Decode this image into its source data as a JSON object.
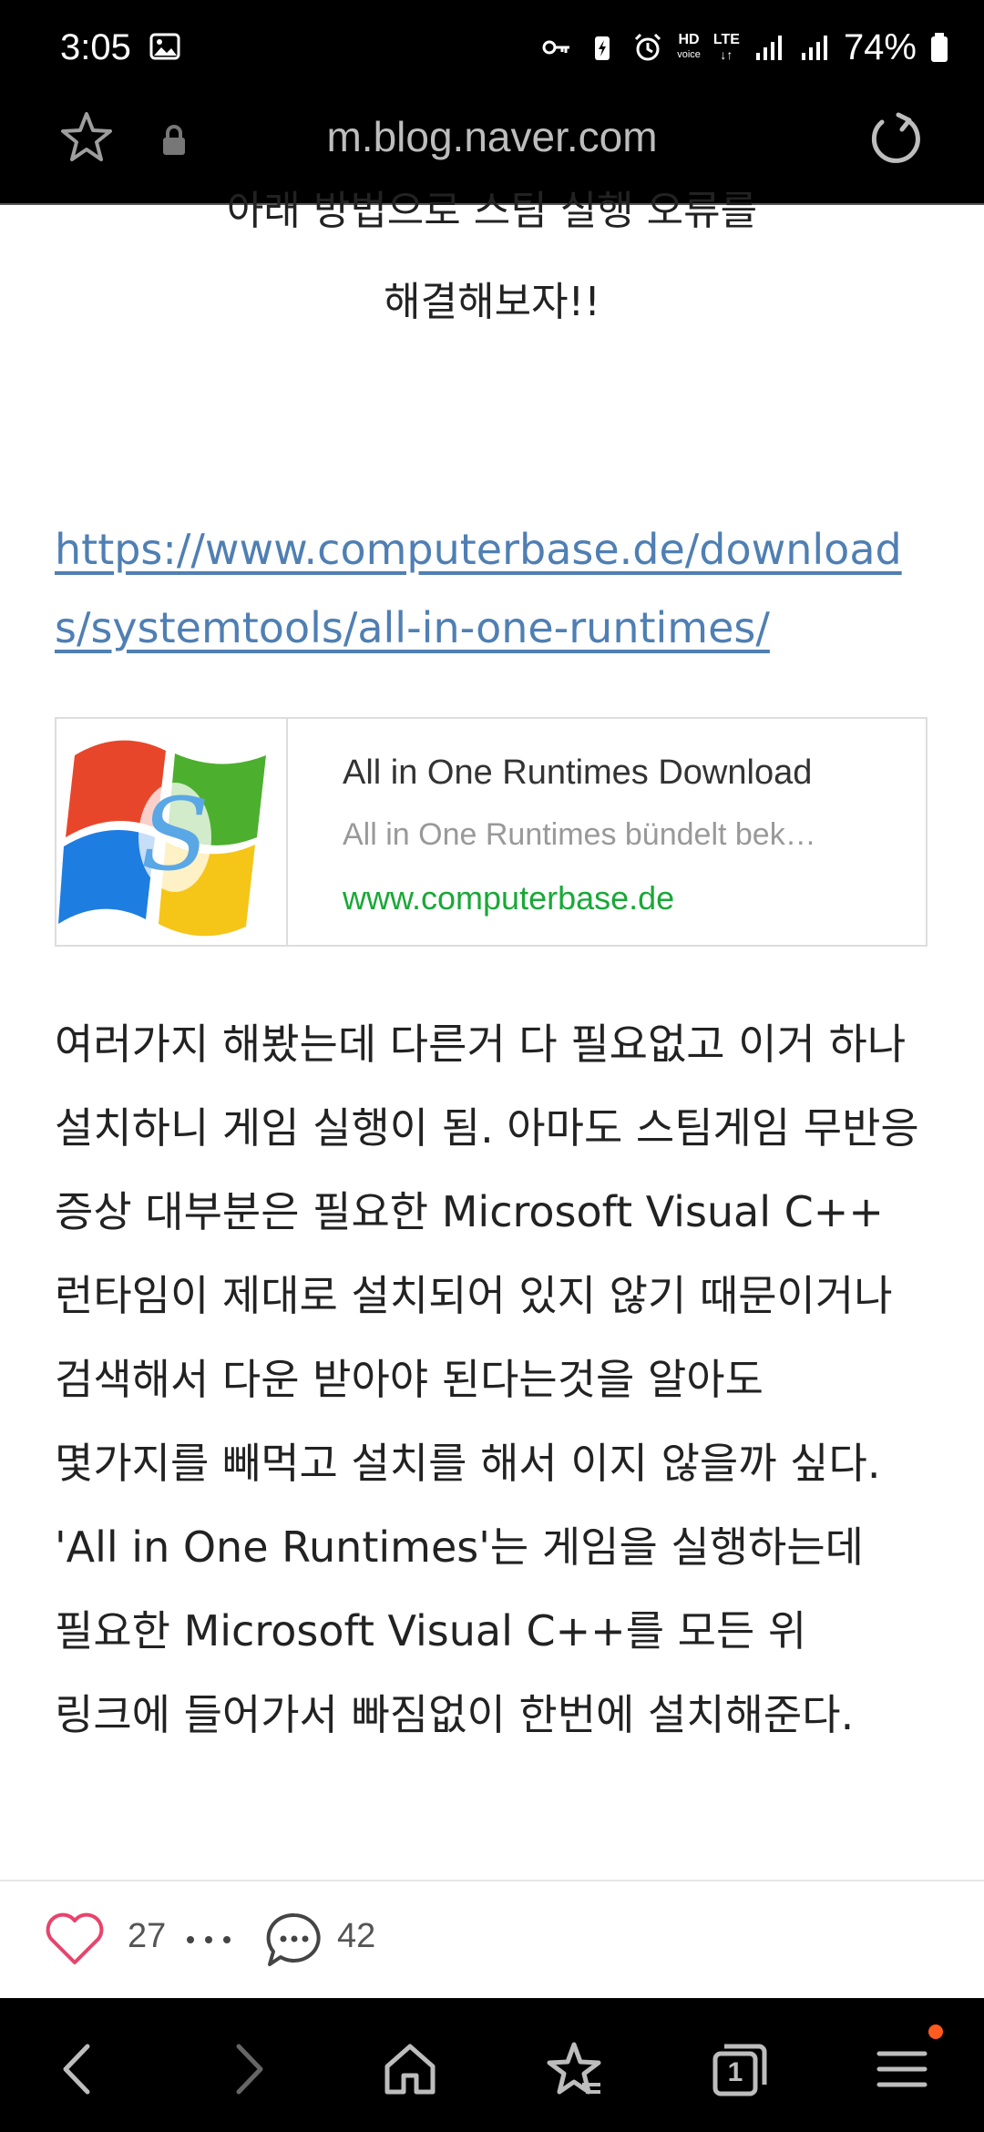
{
  "status_bar": {
    "time": "3:05",
    "hd_label": "HD",
    "voice_label": "voice",
    "lte_label": "LTE",
    "battery": "74%"
  },
  "url_bar": {
    "domain": "m.blog.naver.com"
  },
  "article": {
    "partial_top_line": "아래 방법으로 스팀 실행 오류를",
    "center_line": "해결해보자!!",
    "link_url": "https://www.computerbase.de/downloads/systemtools/all-in-one-runtimes/",
    "card": {
      "title": "All in One Runtimes Download",
      "description": "All in One Runtimes bündelt bek…",
      "domain": "www.computerbase.de"
    },
    "paragraph": "여러가지 해봤는데 다른거 다 필요없고 이거 하나 설치하니 게임 실행이 됨. 아마도 스팀게임 무반응 증상 대부분은 필요한 Microsoft Visual C++ 런타임이 제대로 설치되어 있지 않기 때문이거나 검색해서 다운 받아야 된다는것을 알아도 몇가지를 빼먹고 설치를 해서 이지 않을까 싶다. 'All in One Runtimes'는 게임을 실행하는데 필요한 Microsoft Visual C++를 모든  위 링크에 들어가서 빠짐없이 한번에 설치해준다."
  },
  "reactions": {
    "like_count": "27",
    "comment_count": "42"
  },
  "nav": {
    "tabs_count": "1"
  },
  "colors": {
    "link": "#4f7fb3",
    "domain_green": "#1aa838",
    "heart": "#e8436c",
    "notification_dot": "#ff5a1f"
  }
}
